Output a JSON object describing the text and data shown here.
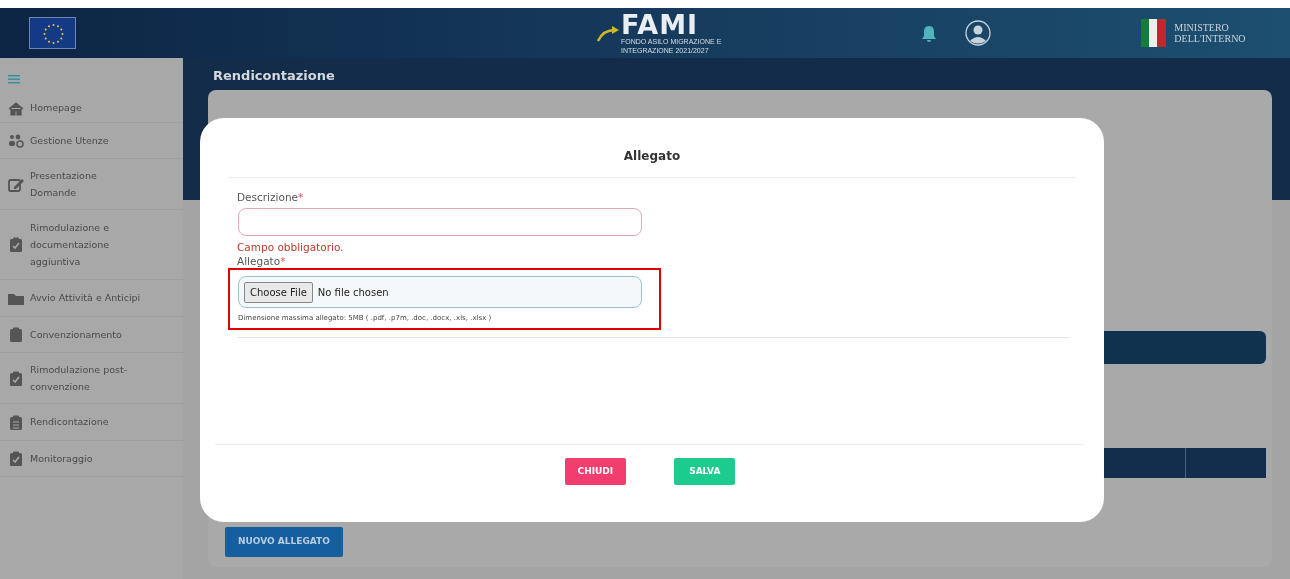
{
  "header": {
    "logo_title": "FAMI",
    "logo_subtitle": [
      "FONDO ASILO MIGRAZIONE E",
      "INTEGRAZIONE 2021/2027"
    ],
    "ministry": [
      "MINISTERO",
      "DELL'INTERNO"
    ]
  },
  "sidebar": {
    "items": [
      {
        "label": "Homepage",
        "kind": "home"
      },
      {
        "label": "Gestione Utenze",
        "kind": "users"
      },
      {
        "label": "Presentazione Domande",
        "kind": "edit"
      },
      {
        "label": "Rimodulazione e documentazione aggiuntiva",
        "kind": "clipcheck"
      },
      {
        "label": "Avvio Attività e Anticipi",
        "kind": "folder"
      },
      {
        "label": "Convenzionamento",
        "kind": "clip"
      },
      {
        "label": "Rimodulazione post-convenzione",
        "kind": "clipcheck"
      },
      {
        "label": "Rendicontazione",
        "kind": "cliplist"
      },
      {
        "label": "Monitoraggio",
        "kind": "clipcheck"
      }
    ]
  },
  "page": {
    "title": "Rendicontazione",
    "new_button": "NUOVO ALLEGATO"
  },
  "modal": {
    "title": "Allegato",
    "fields": [
      {
        "kind": "text",
        "label": "Descrizione",
        "required_mark": "*",
        "invalid": true,
        "error": "Campo obbligatorio.",
        "highlighted": false
      },
      {
        "kind": "file",
        "label": "Allegato",
        "required_mark": "*",
        "invalid": false,
        "button": "Choose File",
        "value": "No file chosen",
        "hint": "Dimensione massima allegato: 5MB ( .pdf, .p7m, .doc, .docx, .xls, .xlsx )",
        "highlighted": true
      }
    ],
    "buttons": [
      {
        "label": "CHIUDI",
        "kind": "danger"
      },
      {
        "label": "SALVA",
        "kind": "success"
      }
    ]
  }
}
